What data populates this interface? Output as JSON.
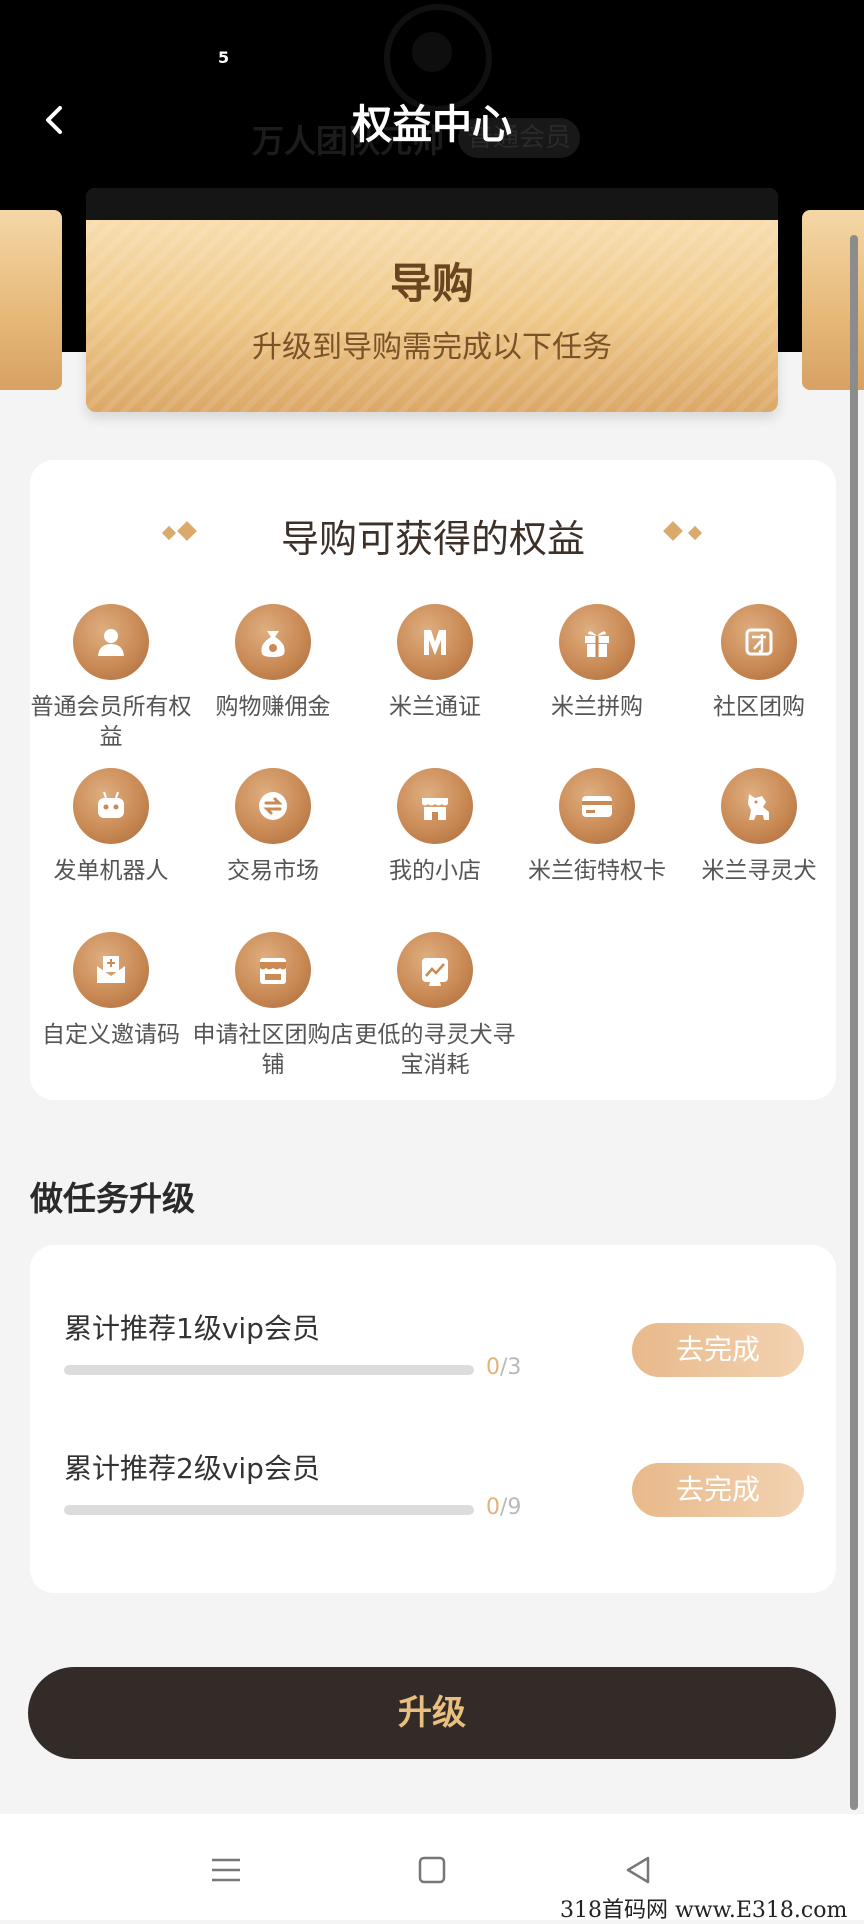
{
  "status": {
    "notification_count": "5"
  },
  "header": {
    "title": "权益中心",
    "background_text": "万人团队元帅",
    "background_badge": "普通会员"
  },
  "level_card": {
    "name": "导购",
    "subtitle": "升级到导购需完成以下任务"
  },
  "benefits": {
    "title": "导购可获得的权益",
    "items": [
      {
        "label": "普通会员所有权益",
        "icon": "person-icon"
      },
      {
        "label": "购物赚佣金",
        "icon": "money-bag-icon"
      },
      {
        "label": "米兰通证",
        "icon": "milan-token-icon"
      },
      {
        "label": "米兰拼购",
        "icon": "gift-icon"
      },
      {
        "label": "社区团购",
        "icon": "group-buy-icon"
      },
      {
        "label": "发单机器人",
        "icon": "robot-icon"
      },
      {
        "label": "交易市场",
        "icon": "exchange-icon"
      },
      {
        "label": "我的小店",
        "icon": "shop-icon"
      },
      {
        "label": "米兰街特权卡",
        "icon": "card-icon"
      },
      {
        "label": "米兰寻灵犬",
        "icon": "dog-icon"
      },
      {
        "label": "自定义邀请码",
        "icon": "invite-envelope-icon"
      },
      {
        "label": "申请社区团购店铺",
        "icon": "store-icon"
      },
      {
        "label": "更低的寻灵犬寻宝消耗",
        "icon": "treasure-icon"
      }
    ]
  },
  "tasks": {
    "section_title": "做任务升级",
    "items": [
      {
        "title": "累计推荐1级vip会员",
        "current": "0",
        "total": "/3",
        "progress": 0,
        "button": "去完成"
      },
      {
        "title": "累计推荐2级vip会员",
        "current": "0",
        "total": "/9",
        "progress": 0,
        "button": "去完成"
      }
    ]
  },
  "upgrade_button": "升级",
  "watermark": "318首码网 www.E318.com",
  "colors": {
    "accent_gold": "#d9a46a",
    "button_dark": "#332b28",
    "header_bg": "#000000"
  }
}
